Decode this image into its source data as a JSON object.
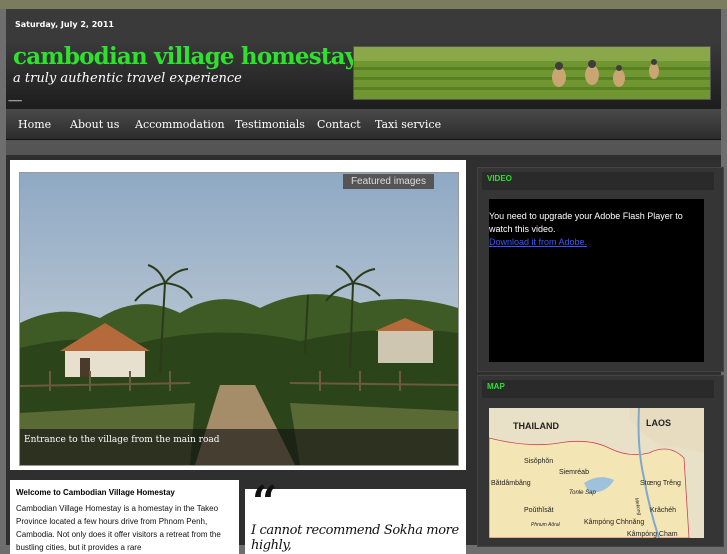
{
  "date": "Saturday, July 2, 2011",
  "site": {
    "title": "cambodian village homestay",
    "tagline": "a truly authentic travel experience",
    "dashes": "--------"
  },
  "nav": [
    "Home",
    "About us",
    "Accommodation",
    "Testimonials",
    "Contact",
    "Taxi service"
  ],
  "featured": {
    "label": "Featured images",
    "caption": "Entrance to the village from the main road"
  },
  "video": {
    "title": "VIDEO",
    "message": "You need to upgrade your Adobe Flash Player to watch this video.",
    "link": "Download it from Adobe."
  },
  "map": {
    "title": "MAP",
    "labels": {
      "thailand": "THAILAND",
      "laos": "LAOS",
      "sisophon": "Sisŏphŏn",
      "siemreab": "Siemréab",
      "batdambang": "Bătdâmbâng",
      "tonle_sap": "Tonle Sap",
      "stoeng_treng": "Stœng Trêng",
      "pouthisat": "Poŭthĭsăt",
      "kracheh": "Krâchéh",
      "phnom_aoral": "Phnum Aôral",
      "kampong_chhnang": "Kâmpóng Chhnăng",
      "mekong": "Mekong",
      "kampong_cham": "Kâmpóng Cham"
    }
  },
  "welcome": {
    "title": "Welcome to Cambodian Village Homestay",
    "text": "Cambodian Village Homestay is a homestay in the Takeo Province located a few hours drive from Phnom Penh, Cambodia. Not only does it offer visitors a retreat from the bustling cities, but it provides a rare"
  },
  "testimonial": {
    "quote_mark": "“",
    "text": "I cannot recommend Sokha more highly,"
  },
  "colors": {
    "accent": "#2fe02f",
    "background": "#6e6e6e",
    "panel": "#2f2f2f",
    "link": "#3a55ff"
  }
}
